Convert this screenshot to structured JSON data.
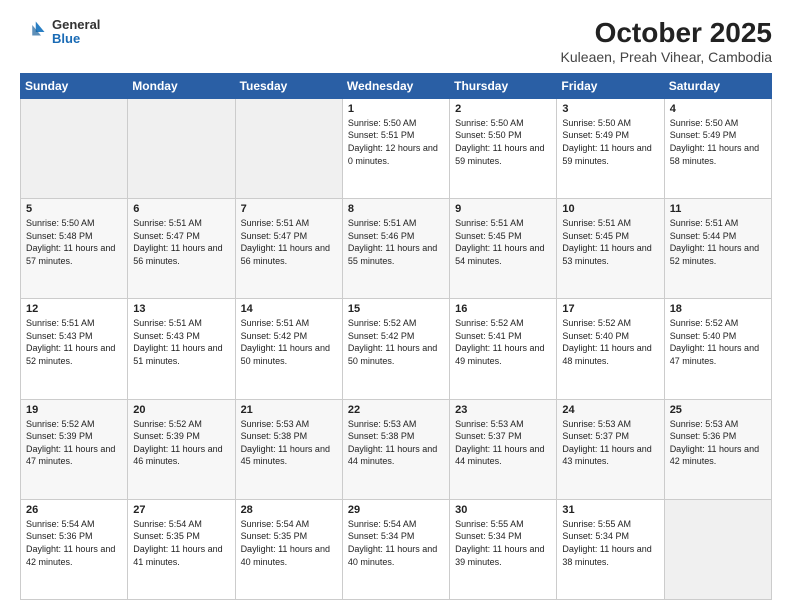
{
  "header": {
    "logo": {
      "general": "General",
      "blue": "Blue"
    },
    "title": "October 2025",
    "subtitle": "Kuleaen, Preah Vihear, Cambodia"
  },
  "weekdays": [
    "Sunday",
    "Monday",
    "Tuesday",
    "Wednesday",
    "Thursday",
    "Friday",
    "Saturday"
  ],
  "weeks": [
    [
      {
        "day": "",
        "sunrise": "",
        "sunset": "",
        "daylight": ""
      },
      {
        "day": "",
        "sunrise": "",
        "sunset": "",
        "daylight": ""
      },
      {
        "day": "",
        "sunrise": "",
        "sunset": "",
        "daylight": ""
      },
      {
        "day": "1",
        "sunrise": "Sunrise: 5:50 AM",
        "sunset": "Sunset: 5:51 PM",
        "daylight": "Daylight: 12 hours and 0 minutes."
      },
      {
        "day": "2",
        "sunrise": "Sunrise: 5:50 AM",
        "sunset": "Sunset: 5:50 PM",
        "daylight": "Daylight: 11 hours and 59 minutes."
      },
      {
        "day": "3",
        "sunrise": "Sunrise: 5:50 AM",
        "sunset": "Sunset: 5:49 PM",
        "daylight": "Daylight: 11 hours and 59 minutes."
      },
      {
        "day": "4",
        "sunrise": "Sunrise: 5:50 AM",
        "sunset": "Sunset: 5:49 PM",
        "daylight": "Daylight: 11 hours and 58 minutes."
      }
    ],
    [
      {
        "day": "5",
        "sunrise": "Sunrise: 5:50 AM",
        "sunset": "Sunset: 5:48 PM",
        "daylight": "Daylight: 11 hours and 57 minutes."
      },
      {
        "day": "6",
        "sunrise": "Sunrise: 5:51 AM",
        "sunset": "Sunset: 5:47 PM",
        "daylight": "Daylight: 11 hours and 56 minutes."
      },
      {
        "day": "7",
        "sunrise": "Sunrise: 5:51 AM",
        "sunset": "Sunset: 5:47 PM",
        "daylight": "Daylight: 11 hours and 56 minutes."
      },
      {
        "day": "8",
        "sunrise": "Sunrise: 5:51 AM",
        "sunset": "Sunset: 5:46 PM",
        "daylight": "Daylight: 11 hours and 55 minutes."
      },
      {
        "day": "9",
        "sunrise": "Sunrise: 5:51 AM",
        "sunset": "Sunset: 5:45 PM",
        "daylight": "Daylight: 11 hours and 54 minutes."
      },
      {
        "day": "10",
        "sunrise": "Sunrise: 5:51 AM",
        "sunset": "Sunset: 5:45 PM",
        "daylight": "Daylight: 11 hours and 53 minutes."
      },
      {
        "day": "11",
        "sunrise": "Sunrise: 5:51 AM",
        "sunset": "Sunset: 5:44 PM",
        "daylight": "Daylight: 11 hours and 52 minutes."
      }
    ],
    [
      {
        "day": "12",
        "sunrise": "Sunrise: 5:51 AM",
        "sunset": "Sunset: 5:43 PM",
        "daylight": "Daylight: 11 hours and 52 minutes."
      },
      {
        "day": "13",
        "sunrise": "Sunrise: 5:51 AM",
        "sunset": "Sunset: 5:43 PM",
        "daylight": "Daylight: 11 hours and 51 minutes."
      },
      {
        "day": "14",
        "sunrise": "Sunrise: 5:51 AM",
        "sunset": "Sunset: 5:42 PM",
        "daylight": "Daylight: 11 hours and 50 minutes."
      },
      {
        "day": "15",
        "sunrise": "Sunrise: 5:52 AM",
        "sunset": "Sunset: 5:42 PM",
        "daylight": "Daylight: 11 hours and 50 minutes."
      },
      {
        "day": "16",
        "sunrise": "Sunrise: 5:52 AM",
        "sunset": "Sunset: 5:41 PM",
        "daylight": "Daylight: 11 hours and 49 minutes."
      },
      {
        "day": "17",
        "sunrise": "Sunrise: 5:52 AM",
        "sunset": "Sunset: 5:40 PM",
        "daylight": "Daylight: 11 hours and 48 minutes."
      },
      {
        "day": "18",
        "sunrise": "Sunrise: 5:52 AM",
        "sunset": "Sunset: 5:40 PM",
        "daylight": "Daylight: 11 hours and 47 minutes."
      }
    ],
    [
      {
        "day": "19",
        "sunrise": "Sunrise: 5:52 AM",
        "sunset": "Sunset: 5:39 PM",
        "daylight": "Daylight: 11 hours and 47 minutes."
      },
      {
        "day": "20",
        "sunrise": "Sunrise: 5:52 AM",
        "sunset": "Sunset: 5:39 PM",
        "daylight": "Daylight: 11 hours and 46 minutes."
      },
      {
        "day": "21",
        "sunrise": "Sunrise: 5:53 AM",
        "sunset": "Sunset: 5:38 PM",
        "daylight": "Daylight: 11 hours and 45 minutes."
      },
      {
        "day": "22",
        "sunrise": "Sunrise: 5:53 AM",
        "sunset": "Sunset: 5:38 PM",
        "daylight": "Daylight: 11 hours and 44 minutes."
      },
      {
        "day": "23",
        "sunrise": "Sunrise: 5:53 AM",
        "sunset": "Sunset: 5:37 PM",
        "daylight": "Daylight: 11 hours and 44 minutes."
      },
      {
        "day": "24",
        "sunrise": "Sunrise: 5:53 AM",
        "sunset": "Sunset: 5:37 PM",
        "daylight": "Daylight: 11 hours and 43 minutes."
      },
      {
        "day": "25",
        "sunrise": "Sunrise: 5:53 AM",
        "sunset": "Sunset: 5:36 PM",
        "daylight": "Daylight: 11 hours and 42 minutes."
      }
    ],
    [
      {
        "day": "26",
        "sunrise": "Sunrise: 5:54 AM",
        "sunset": "Sunset: 5:36 PM",
        "daylight": "Daylight: 11 hours and 42 minutes."
      },
      {
        "day": "27",
        "sunrise": "Sunrise: 5:54 AM",
        "sunset": "Sunset: 5:35 PM",
        "daylight": "Daylight: 11 hours and 41 minutes."
      },
      {
        "day": "28",
        "sunrise": "Sunrise: 5:54 AM",
        "sunset": "Sunset: 5:35 PM",
        "daylight": "Daylight: 11 hours and 40 minutes."
      },
      {
        "day": "29",
        "sunrise": "Sunrise: 5:54 AM",
        "sunset": "Sunset: 5:34 PM",
        "daylight": "Daylight: 11 hours and 40 minutes."
      },
      {
        "day": "30",
        "sunrise": "Sunrise: 5:55 AM",
        "sunset": "Sunset: 5:34 PM",
        "daylight": "Daylight: 11 hours and 39 minutes."
      },
      {
        "day": "31",
        "sunrise": "Sunrise: 5:55 AM",
        "sunset": "Sunset: 5:34 PM",
        "daylight": "Daylight: 11 hours and 38 minutes."
      },
      {
        "day": "",
        "sunrise": "",
        "sunset": "",
        "daylight": ""
      }
    ]
  ]
}
